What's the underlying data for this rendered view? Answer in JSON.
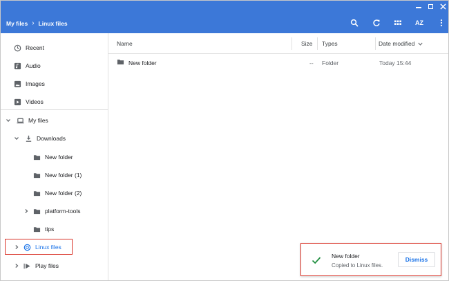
{
  "header": {
    "breadcrumb": [
      "My files",
      "Linux files"
    ],
    "breadcrumb_sep": "›",
    "sort_label": "AZ",
    "accent": "#3c78d8"
  },
  "sidebar": {
    "recent": "Recent",
    "audio": "Audio",
    "images": "Images",
    "videos": "Videos",
    "my_files": "My files",
    "downloads": "Downloads",
    "folders": [
      "New folder",
      "New folder (1)",
      "New folder (2)",
      "platform-tools",
      "tips"
    ],
    "linux_files": "Linux files",
    "play_files": "Play files"
  },
  "table": {
    "columns": {
      "name": "Name",
      "size": "Size",
      "type": "Types",
      "date": "Date modified"
    },
    "rows": [
      {
        "name": "New folder",
        "size": "--",
        "type": "Folder",
        "date": "Today 15:44"
      }
    ]
  },
  "toast": {
    "title": "New folder",
    "message": "Copied to Linux files.",
    "dismiss": "Dismiss"
  }
}
